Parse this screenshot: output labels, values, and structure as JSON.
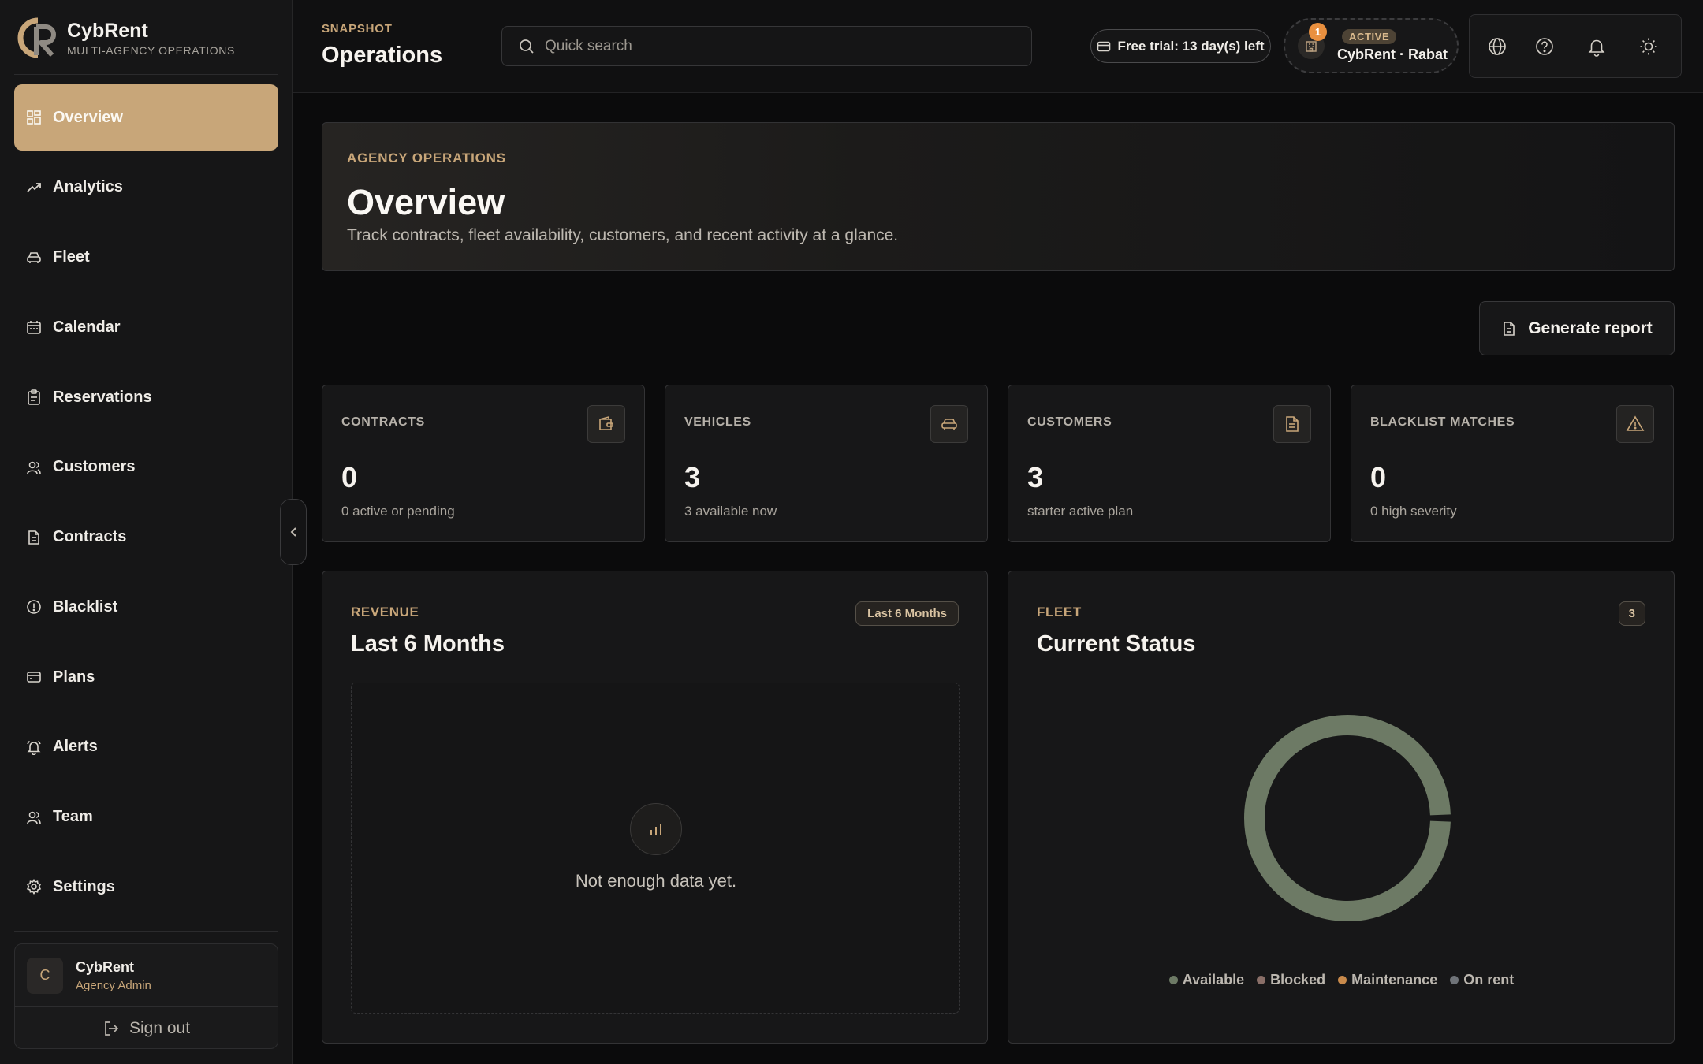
{
  "brand": {
    "name": "CybRent",
    "subtitle": "MULTI-AGENCY OPERATIONS"
  },
  "sidebar": {
    "items": [
      {
        "label": "Overview",
        "icon": "grid-icon",
        "active": true
      },
      {
        "label": "Analytics",
        "icon": "trend-icon"
      },
      {
        "label": "Fleet",
        "icon": "car-icon"
      },
      {
        "label": "Calendar",
        "icon": "calendar-icon"
      },
      {
        "label": "Reservations",
        "icon": "clipboard-icon"
      },
      {
        "label": "Customers",
        "icon": "users-icon"
      },
      {
        "label": "Contracts",
        "icon": "document-icon"
      },
      {
        "label": "Blacklist",
        "icon": "alert-circle-icon"
      },
      {
        "label": "Plans",
        "icon": "credit-card-icon"
      },
      {
        "label": "Alerts",
        "icon": "bell-ring-icon"
      },
      {
        "label": "Team",
        "icon": "team-icon"
      },
      {
        "label": "Settings",
        "icon": "gear-icon"
      }
    ]
  },
  "user": {
    "initial": "C",
    "name": "CybRent",
    "role": "Agency Admin",
    "signout_label": "Sign out"
  },
  "header": {
    "eyebrow": "SNAPSHOT",
    "title": "Operations",
    "search_placeholder": "Quick search",
    "trial_label": "Free trial: 13 day(s) left",
    "agency_status": "ACTIVE",
    "agency_name": "CybRent · Rabat",
    "notification_count": "1"
  },
  "hero": {
    "eyebrow": "AGENCY OPERATIONS",
    "title": "Overview",
    "subtitle": "Track contracts, fleet availability, customers, and recent activity at a glance."
  },
  "actions": {
    "generate_report": "Generate report"
  },
  "stats": [
    {
      "label": "CONTRACTS",
      "value": "0",
      "sub": "0 active or pending",
      "icon": "wallet-icon"
    },
    {
      "label": "VEHICLES",
      "value": "3",
      "sub": "3 available now",
      "icon": "car-icon"
    },
    {
      "label": "CUSTOMERS",
      "value": "3",
      "sub": "starter active plan",
      "icon": "document-icon"
    },
    {
      "label": "BLACKLIST MATCHES",
      "value": "0",
      "sub": "0 high severity",
      "icon": "warning-icon"
    }
  ],
  "revenue": {
    "eyebrow": "REVENUE",
    "title": "Last 6 Months",
    "pill": "Last 6 Months",
    "empty_text": "Not enough data yet."
  },
  "fleet": {
    "eyebrow": "FLEET",
    "title": "Current Status",
    "count": "3",
    "legend": [
      {
        "label": "Available",
        "color": "#6d7a65"
      },
      {
        "label": "Blocked",
        "color": "#8a6f68"
      },
      {
        "label": "Maintenance",
        "color": "#c98a4b"
      },
      {
        "label": "On rent",
        "color": "#6f7378"
      }
    ]
  },
  "chart_data": {
    "type": "pie",
    "categories": [
      "Available",
      "Blocked",
      "Maintenance",
      "On rent"
    ],
    "values": [
      3,
      0,
      0,
      0
    ],
    "colors": [
      "#6d7a65",
      "#8a6f68",
      "#c98a4b",
      "#6f7378"
    ],
    "legend": "bottom",
    "title": "Current Status"
  }
}
